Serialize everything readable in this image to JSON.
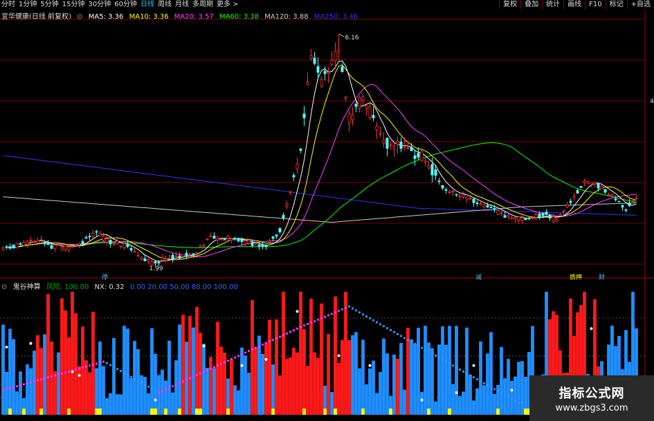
{
  "toolbar": {
    "periods": [
      "分时",
      "1分钟",
      "5分钟",
      "15分钟",
      "30分钟",
      "60分钟",
      "日线",
      "周线",
      "月线",
      "多周期",
      "更多 >"
    ],
    "active_period": "日线",
    "actions": [
      "复权",
      "叠加",
      "统计",
      "画线",
      "F10",
      "标记",
      "+自选"
    ]
  },
  "main_legend": {
    "stock": "宜华健康(日线 前复权)",
    "ma5": "MA5: 3.36",
    "ma10": "MA10: 3.36",
    "ma20": "MA20: 3.57",
    "ma60": "MA60: 3.38",
    "ma120": "MA120: 3.88",
    "ma250": "MA250: 3.46"
  },
  "colors": {
    "up": "#ff3333",
    "down": "#54ffff",
    "ma5": "#ffffff",
    "ma10": "#ffff00",
    "ma20": "#ff44ff",
    "ma60": "#00ff00",
    "ma120": "#cccccc",
    "ma250": "#3333ff",
    "red_bar": "#ff1a1a",
    "blue_bar": "#1f8fff",
    "yellow_bar": "#ffff00",
    "grid": "#7a0000"
  },
  "annotations": {
    "high": "6.16",
    "low": "1.99",
    "right_label": "4"
  },
  "events": [
    "停",
    "减",
    "质押",
    "财"
  ],
  "indicator_legend": {
    "name": "鬼谷神算",
    "risk": "风险: 100.00",
    "nx": "NX: 0.32",
    "levels": "0.00  20.00  50.00  80.00  100.00"
  },
  "watermark": {
    "title": "指标公式网",
    "url": "www.zbgs3.com"
  }
}
